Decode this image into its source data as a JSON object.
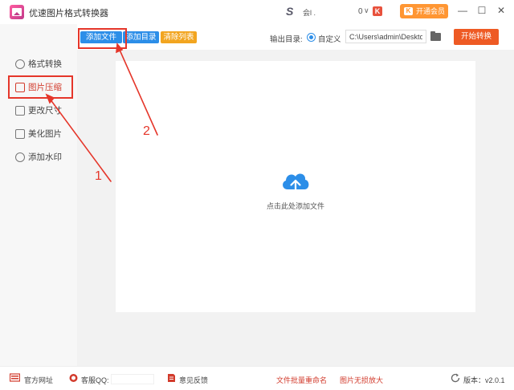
{
  "titlebar": {
    "app_title": "优速图片格式转换器",
    "user_name": "会l .",
    "coin_count": "0",
    "coin_chevron": "∨",
    "vip_label": "开通会员",
    "vip_icon": "K",
    "coin_icon": "K",
    "minimize": "—",
    "maximize": "☐",
    "close": "✕",
    "menu": "≡"
  },
  "sidebar": {
    "items": [
      {
        "label": "格式转换",
        "icon": "format-convert-icon"
      },
      {
        "label": "图片压缩",
        "icon": "compress-icon",
        "active": true
      },
      {
        "label": "更改尺寸",
        "icon": "resize-icon"
      },
      {
        "label": "美化图片",
        "icon": "beautify-icon"
      },
      {
        "label": "添加水印",
        "icon": "watermark-icon"
      }
    ]
  },
  "toolbar": {
    "add_file": "添加文件",
    "add_dir": "添加目录",
    "clear_list": "清除列表",
    "output_label": "输出目录:",
    "custom_label": "自定义",
    "path_value": "C:\\Users\\admin\\Deskto",
    "start_button": "开始转换"
  },
  "main": {
    "drop_hint": "点击此处添加文件"
  },
  "annotations": {
    "num1": "1",
    "num2": "2"
  },
  "footer": {
    "official_site": "官方网址",
    "support_qq": "客服QQ:",
    "feedback": "意见反馈",
    "batch_rename": "文件批量重命名",
    "lossless_enlarge": "图片无损放大",
    "version": "版本：v2.0.1"
  },
  "colors": {
    "accent_blue": "#2c8ee8",
    "accent_orange": "#f2a520",
    "start_red": "#ee5a24",
    "annotation_red": "#e5362a",
    "vip_orange": "#ff9633"
  }
}
